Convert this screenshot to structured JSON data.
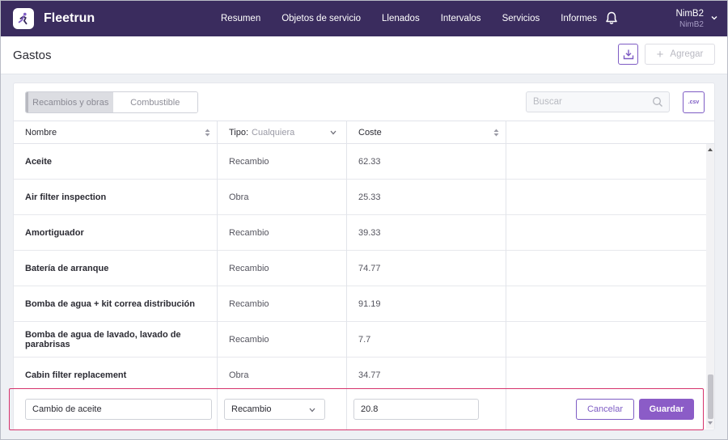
{
  "app": {
    "brand": "Fleetrun"
  },
  "nav": {
    "items": [
      "Resumen",
      "Objetos de servicio",
      "Llenados",
      "Intervalos",
      "Servicios",
      "Informes"
    ]
  },
  "user": {
    "name": "NimB2",
    "account": "NimB2"
  },
  "page": {
    "title": "Gastos",
    "add_label": "Agregar"
  },
  "tabs": {
    "parts": "Recambios y obras",
    "fuel": "Combustible"
  },
  "search": {
    "placeholder": "Buscar"
  },
  "csv": {
    "label": ".csv"
  },
  "table": {
    "columns": {
      "name": "Nombre",
      "type": "Tipo:",
      "type_filter": "Cualquiera",
      "cost": "Coste"
    },
    "rows": [
      {
        "name": "Aceite",
        "type": "Recambio",
        "cost": "62.33"
      },
      {
        "name": "Air filter inspection",
        "type": "Obra",
        "cost": "25.33"
      },
      {
        "name": "Amortiguador",
        "type": "Recambio",
        "cost": "39.33"
      },
      {
        "name": "Batería de arranque",
        "type": "Recambio",
        "cost": "74.77"
      },
      {
        "name": "Bomba de agua + kit correa distribución",
        "type": "Recambio",
        "cost": "91.19"
      },
      {
        "name": "Bomba de agua de lavado, lavado de parabrisas",
        "type": "Recambio",
        "cost": "7.7"
      },
      {
        "name": "Cabin filter replacement",
        "type": "Obra",
        "cost": "34.77"
      }
    ]
  },
  "edit_row": {
    "name": "Cambio de aceite",
    "type": "Recambio",
    "cost": "20.8",
    "cancel_label": "Cancelar",
    "save_label": "Guardar"
  },
  "colors": {
    "nav_bg": "#3a2c5e",
    "accent": "#7e5cc4",
    "save_bg": "#8b5cc7",
    "highlight": "#d6336c"
  }
}
